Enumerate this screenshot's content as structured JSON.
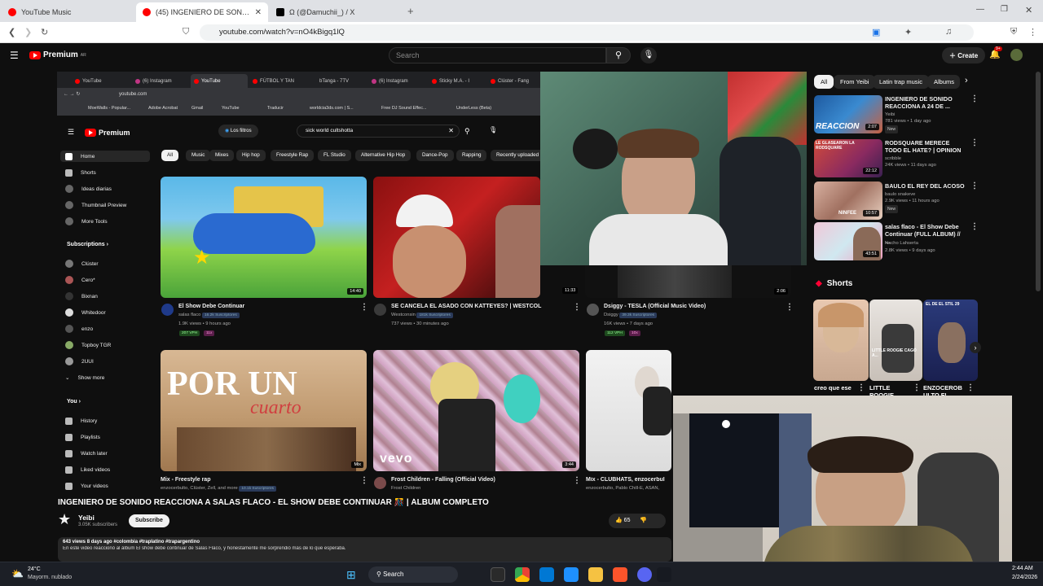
{
  "browser": {
    "tabs": [
      {
        "label": "YouTube Music",
        "color": "#ff0000"
      },
      {
        "label": "(45) INGENIERO DE SONIDO",
        "color": "#ff0000"
      },
      {
        "label": "Ω (@Damuchii_) / X",
        "color": "#000000"
      }
    ],
    "url": "youtube.com/watch?v=nO4kBigq1lQ"
  },
  "header": {
    "logo": "Premium",
    "logo_sup": "AR",
    "search_placeholder": "Search",
    "create_label": "Create",
    "notif_count": "9+"
  },
  "inner": {
    "tabs": [
      "YouTube",
      "(6) Instagram",
      "YouTube",
      "FÚTBOL Y TAN",
      "bTanga - 7TV",
      "(6) Instagram",
      "Sticky M.A. - I",
      "Clúster - Fang"
    ],
    "url": "youtube.com",
    "bookmarks": [
      "MoeWalls - Popular...",
      "Adobe Acrobat",
      "Gmail",
      "YouTube",
      "Traducir",
      "worldcia3ds.com | S...",
      "Free DJ Sound Effec...",
      "UnderLess (Beta)"
    ],
    "logo": "Premium",
    "filters_label": "Los filtros",
    "search_value": "sick world cultshotta",
    "side_main": [
      "Home",
      "Shorts",
      "Ideas diarias",
      "Thumbnail Preview",
      "More Tools"
    ],
    "subs_header": "Subscriptions",
    "subs": [
      "Clúster",
      "Cero*",
      "Bixnan",
      "Whitedoor",
      "enzo",
      "Topboy TGR",
      "2UUI"
    ],
    "show_more": "Show more",
    "you_header": "You",
    "you_items": [
      "History",
      "Playlists",
      "Watch later",
      "Liked videos",
      "Your videos"
    ],
    "chips": [
      "All",
      "Music",
      "Mixes",
      "Hip hop",
      "Freestyle Rap",
      "FL Studio",
      "Alternative Hip Hop",
      "Dance-Pop",
      "Rapping",
      "Recently uploaded"
    ],
    "videos": [
      {
        "title": "El Show Debe Continuar",
        "channel": "salas flaco",
        "subs": "16.2k Suscriptores",
        "meta": "1.9K views • 9 hours ago",
        "vph": "207 VPH",
        "pill": "11x",
        "dur": "14:40"
      },
      {
        "title": "SE CANCELA EL ASADO CON KATTEYES? | WESTCOL",
        "channel": "Westconsin",
        "subs": "181k Suscriptores",
        "meta": "737 views • 30 minutes ago",
        "dur": "11:33"
      },
      {
        "title": "Dsiggy - TESLA (Official Music Video)",
        "channel": "Dsiggy",
        "subs": "39.3k Suscriptores",
        "meta": "16K views • 7 days ago",
        "vph": "112 VPH",
        "pill": "10x",
        "dur": "2:06"
      },
      {
        "title": "Mix - Freestyle rap",
        "channel": "enzocerbulto, Clúster, Zell, and more",
        "subs": "10.1k Suscriptores",
        "dur": "Mix"
      },
      {
        "title": "Frost Children - Falling (Official Video)",
        "channel": "Frost Children",
        "dur": "3:44"
      },
      {
        "title": "Mix - CLUBHATS, enzocerbul",
        "channel": "enzocerbulto, Pablo Chill-E, ASAN,"
      }
    ]
  },
  "watch": {
    "title": "INGENIERO DE SONIDO REACCIONA A SALAS FLACO - EL SHOW DEBE CONTINUAR 🎊 | ÁLBUM COMPLETO",
    "channel": "Yeibi",
    "subs": "3.05K subscribers",
    "subscribe": "Subscribe",
    "likes": "65",
    "desc_meta": "643 views  8 days ago  #colombia #traplatino #trapargentino",
    "desc_line": "En este video reaccionó al álbum El show debe continuar de Salas Flaco, y honestamente me sorprendió más de lo que esperaba."
  },
  "recs": {
    "chips": [
      "All",
      "From Yeibi",
      "Latin trap music",
      "Albums"
    ],
    "items": [
      {
        "title": "INGENIERO DE SONIDO REACCIONA A 24 DE ...",
        "channel": "Yeibi",
        "meta": "781 views • 1 day ago",
        "badge": "New",
        "dur": "2:07",
        "overlay": "REACCION"
      },
      {
        "title": "RODSQUARE MERECE TODO EL HATE? | OPINION",
        "channel": "scribble",
        "meta": "24K views • 11 days ago",
        "dur": "22:12",
        "overlay": "LE GLASEARON LA RODSQUARE"
      },
      {
        "title": "BAULO EL REY DEL ACOSO",
        "channel": "baulo snakeve",
        "meta": "2.9K views • 11 hours ago",
        "badge": "New",
        "dur": "10:57",
        "overlay": "NINFEE"
      },
      {
        "title": "salas flaco - El Show Debe Continuar (FULL ALBUM) // ...",
        "channel": "Nacho Lahserta",
        "meta": "2.8K views • 9 days ago",
        "dur": "43:51"
      }
    ],
    "shorts_header": "Shorts",
    "shorts": [
      "creo que ese",
      "LITTLE ROOGIE",
      "ENZOCEROB ULTO FL"
    ],
    "shorts_overlays": [
      "",
      "LITTLE ROOGIE CAGÓ A...",
      "EL DE EL STIL 29"
    ]
  },
  "taskbar": {
    "temp": "24°C",
    "weather": "Mayorm. nublado",
    "search": "Search",
    "time": "2:44 AM",
    "date": "2/24/2026"
  }
}
